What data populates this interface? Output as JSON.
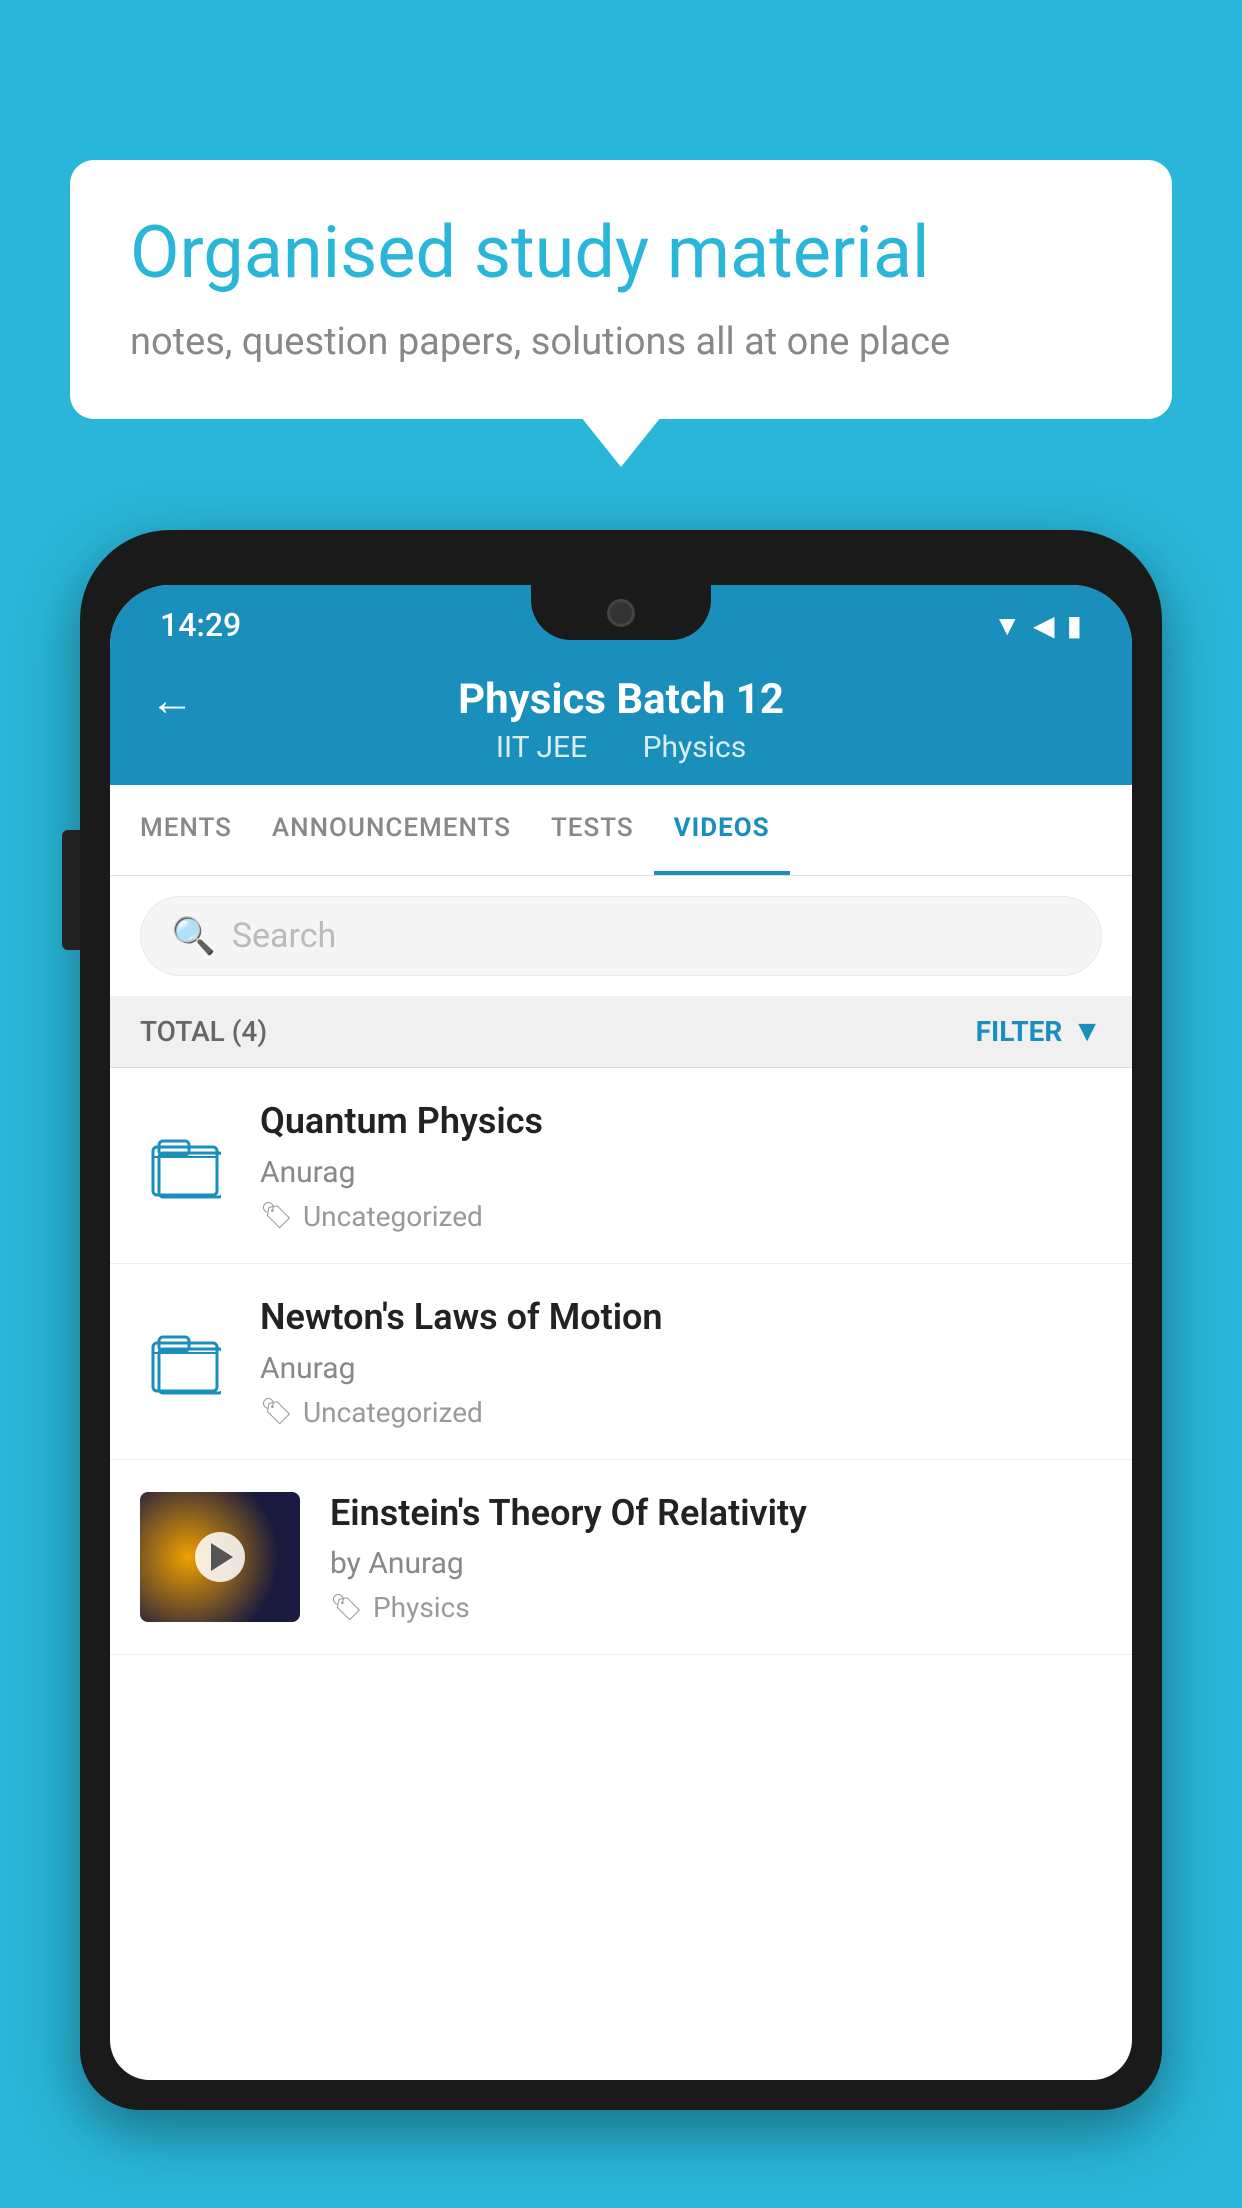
{
  "background_color": "#29B6D8",
  "speech_bubble": {
    "title": "Organised study material",
    "subtitle": "notes, question papers, solutions all at one place"
  },
  "status_bar": {
    "time": "14:29",
    "wifi_icon": "wifi",
    "signal_icon": "signal",
    "battery_icon": "battery"
  },
  "header": {
    "back_label": "←",
    "title": "Physics Batch 12",
    "subtitle_part1": "IIT JEE",
    "subtitle_part2": "Physics"
  },
  "tabs": [
    {
      "label": "MENTS",
      "active": false
    },
    {
      "label": "ANNOUNCEMENTS",
      "active": false
    },
    {
      "label": "TESTS",
      "active": false
    },
    {
      "label": "VIDEOS",
      "active": true
    }
  ],
  "search": {
    "placeholder": "Search"
  },
  "filter_bar": {
    "total_label": "TOTAL (4)",
    "filter_label": "FILTER"
  },
  "videos": [
    {
      "id": 1,
      "title": "Quantum Physics",
      "author": "Anurag",
      "tag": "Uncategorized",
      "has_thumbnail": false
    },
    {
      "id": 2,
      "title": "Newton's Laws of Motion",
      "author": "Anurag",
      "tag": "Uncategorized",
      "has_thumbnail": false
    },
    {
      "id": 3,
      "title": "Einstein's Theory Of Relativity",
      "author": "by Anurag",
      "tag": "Physics",
      "has_thumbnail": true
    }
  ]
}
